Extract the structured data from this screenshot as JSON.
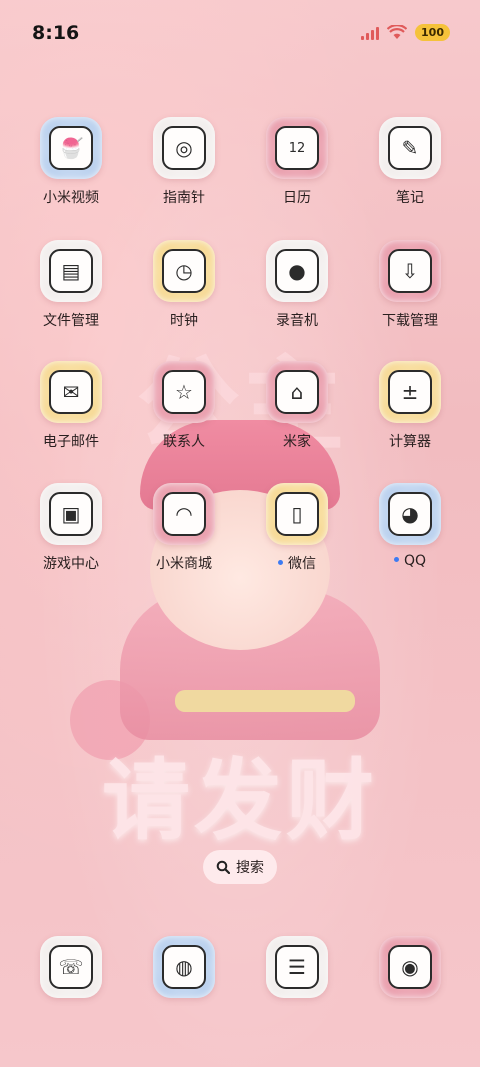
{
  "status_bar": {
    "time": "8:16",
    "battery": "100"
  },
  "wallpaper": {
    "big_text": "请发财",
    "top_text": "公主"
  },
  "apps": [
    {
      "label": "小米视频",
      "icon": "ice-cream-icon",
      "fur": "blue"
    },
    {
      "label": "指南针",
      "icon": "compass-icon",
      "fur": "white"
    },
    {
      "label": "日历",
      "icon": "calendar-heart-icon",
      "fur": "pink",
      "badge": "12"
    },
    {
      "label": "笔记",
      "icon": "notes-icon",
      "fur": "white"
    },
    {
      "label": "文件管理",
      "icon": "folder-icon",
      "fur": "white"
    },
    {
      "label": "时钟",
      "icon": "clock-icon",
      "fur": "yellow"
    },
    {
      "label": "录音机",
      "icon": "recorder-pig-icon",
      "fur": "white"
    },
    {
      "label": "下载管理",
      "icon": "download-icon",
      "fur": "pink"
    },
    {
      "label": "电子邮件",
      "icon": "mail-icon",
      "fur": "yellow"
    },
    {
      "label": "联系人",
      "icon": "contacts-icon",
      "fur": "pink"
    },
    {
      "label": "米家",
      "icon": "mijia-icon",
      "fur": "pink"
    },
    {
      "label": "计算器",
      "icon": "calculator-icon",
      "fur": "yellow"
    },
    {
      "label": "游戏中心",
      "icon": "game-icon",
      "fur": "white"
    },
    {
      "label": "小米商城",
      "icon": "mi-store-icon",
      "fur": "pink"
    },
    {
      "label": "微信",
      "icon": "wechat-milk-icon",
      "fur": "yellow",
      "new_dot": true
    },
    {
      "label": "QQ",
      "icon": "qq-penguin-icon",
      "fur": "blue",
      "new_dot": true
    }
  ],
  "search": {
    "label": "搜索"
  },
  "dock": [
    {
      "icon": "phone-cat-icon",
      "fur": "white"
    },
    {
      "icon": "browser-planet-icon",
      "fur": "blue"
    },
    {
      "icon": "messages-bubble-icon",
      "fur": "white"
    },
    {
      "icon": "camera-frog-icon",
      "fur": "pink"
    }
  ]
}
